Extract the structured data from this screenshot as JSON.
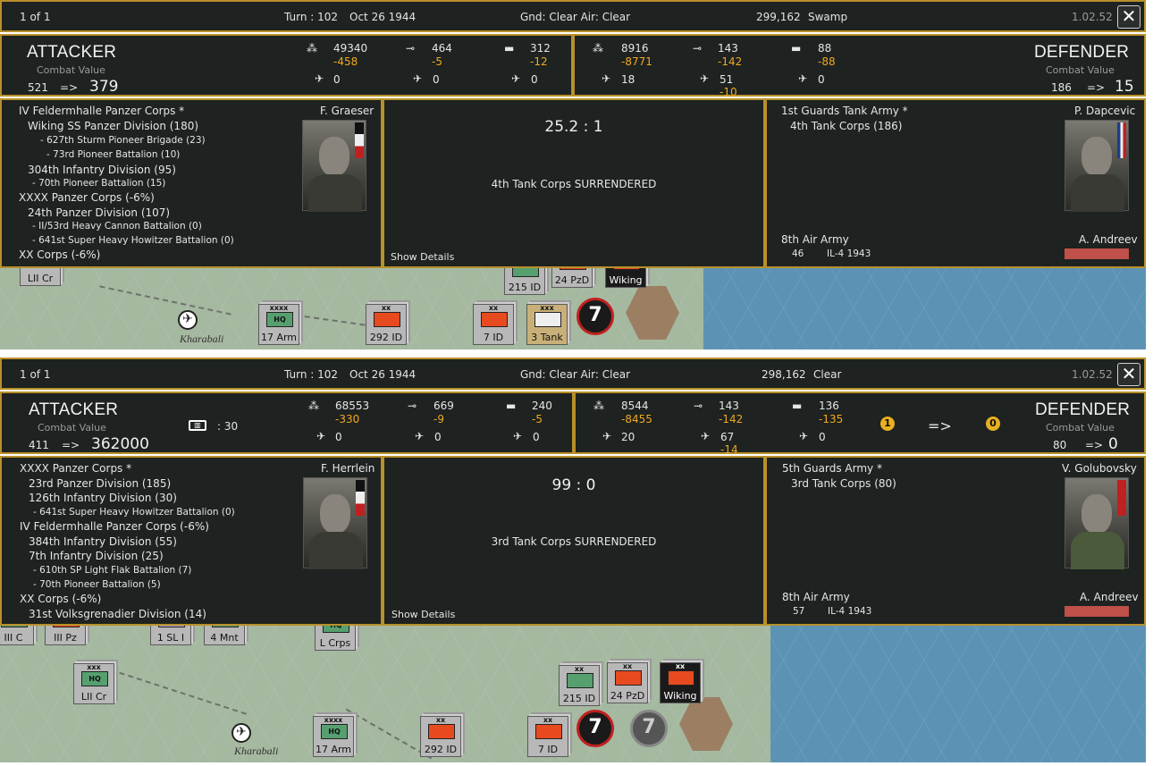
{
  "shots": [
    {
      "topbar": {
        "page": "1 of 1",
        "turn": "Turn : 102",
        "date": "Oct 26 1944",
        "weather": "Gnd: Clear  Air: Clear",
        "hex": "299,162",
        "terrain": "Swamp",
        "version": "1.02.52",
        "close": "✕"
      },
      "attacker": {
        "title": "ATTACKER",
        "cv_label": "Combat Value",
        "cv_before": "521",
        "arrow": "=>",
        "cv_after": "379",
        "men": "49340",
        "men_loss": "-458",
        "guns": "464",
        "guns_loss": "-5",
        "afv": "312",
        "afv_loss": "-12",
        "ftr": "0",
        "bmb": "0",
        "oth": "0",
        "fort_icon": "",
        "fort_value": ""
      },
      "defender": {
        "title": "DEFENDER",
        "cv_label": "Combat Value",
        "cv_before": "186",
        "arrow": "=>",
        "cv_after": "15",
        "men": "8916",
        "men_loss": "-8771",
        "guns": "143",
        "guns_loss": "-142",
        "afv": "88",
        "afv_loss": "-88",
        "ftr": "18",
        "bmb": "51",
        "bmb_loss": "-10",
        "oth": "0"
      },
      "att_panel": {
        "leader": "F. Graeser",
        "rows": [
          {
            "t": "IV Feldermhalle Panzer Corps *",
            "lvl": 0
          },
          {
            "t": "Wiking SS Panzer Division (180)",
            "lvl": 1
          },
          {
            "t": "- 627th Sturm Pioneer Brigade (23)",
            "lvl": 2
          },
          {
            "t": "- 73rd Pioneer Battalion (10)",
            "lvl": 2
          },
          {
            "t": "304th Infantry Division (95)",
            "lvl": 1
          },
          {
            "t": "- 70th Pioneer Battalion (15)",
            "lvl": 2
          },
          {
            "t": "XXXX Panzer Corps (-6%)",
            "lvl": 0
          },
          {
            "t": "24th Panzer Division (107)",
            "lvl": 1
          },
          {
            "t": "- II/53rd Heavy Cannon Battalion (0)",
            "lvl": 2
          },
          {
            "t": "- 641st Super Heavy Howitzer Battalion (0)",
            "lvl": 2
          },
          {
            "t": "XX Corps (-6%)",
            "lvl": 0
          }
        ]
      },
      "mid_panel": {
        "odds": "25.2 : 1",
        "result": "4th Tank Corps SURRENDERED",
        "details": "Show Details"
      },
      "def_panel": {
        "army": "1st Guards Tank Army *",
        "leader": "P. Dapcevic",
        "rows": [
          {
            "t": "4th Tank Corps (186)",
            "lvl": 1
          }
        ],
        "air_army": "8th Air Army",
        "air_leader": "A. Andreev",
        "air_count": "46",
        "air_type": "IL-4 1943"
      },
      "map": {
        "city": "Kharabali",
        "units": [
          {
            "ech": "",
            "sym": "HQ",
            "lbl": "LII Cr",
            "kind": "g"
          },
          {
            "ech": "xxxx",
            "sym": "HQ",
            "lbl": "17 Arm",
            "kind": "g"
          },
          {
            "ech": "xx",
            "sym": "",
            "lbl": "292 ID",
            "kind": "r"
          },
          {
            "ech": "xx",
            "sym": "",
            "lbl": "215 ID",
            "kind": "g"
          },
          {
            "ech": "",
            "sym": "",
            "lbl": "24 PzD",
            "kind": "r"
          },
          {
            "ech": "",
            "sym": "",
            "lbl": "Wiking",
            "kind": "b"
          },
          {
            "ech": "xx",
            "sym": "",
            "lbl": "7 ID",
            "kind": "r"
          },
          {
            "ech": "xxx",
            "sym": "",
            "lbl": "3 Tank",
            "kind": "t"
          }
        ]
      }
    },
    {
      "topbar": {
        "page": "1 of 1",
        "turn": "Turn : 102",
        "date": "Oct 26 1944",
        "weather": "Gnd: Clear  Air: Clear",
        "hex": "298,162",
        "terrain": "Clear",
        "version": "1.02.52",
        "close": "✕"
      },
      "attacker": {
        "title": "ATTACKER",
        "cv_label": "Combat Value",
        "cv_before": "411",
        "arrow": "=>",
        "cv_after": "362000",
        "men": "68553",
        "men_loss": "-330",
        "guns": "669",
        "guns_loss": "-9",
        "afv": "240",
        "afv_loss": "-5",
        "ftr": "0",
        "bmb": "0",
        "oth": "0",
        "fort_icon": "▥",
        "fort_value": ": 30"
      },
      "defender": {
        "title": "DEFENDER",
        "cv_label": "Combat Value",
        "cv_before": "80",
        "arrow": "=>",
        "cv_after": "0",
        "men": "8544",
        "men_loss": "-8455",
        "guns": "143",
        "guns_loss": "-142",
        "afv": "136",
        "afv_loss": "-135",
        "ftr": "20",
        "bmb": "67",
        "bmb_loss": "-14",
        "oth": "0",
        "fort_from": "1",
        "fort_arrow": "=>",
        "fort_to": "0"
      },
      "att_panel": {
        "leader": "F. Herrlein",
        "rows": [
          {
            "t": "XXXX Panzer Corps *",
            "lvl": 0
          },
          {
            "t": "23rd Panzer Division (185)",
            "lvl": 1
          },
          {
            "t": "126th Infantry Division (30)",
            "lvl": 1
          },
          {
            "t": "- 641st Super Heavy Howitzer Battalion (0)",
            "lvl": 2
          },
          {
            "t": "IV Feldermhalle Panzer Corps (-6%)",
            "lvl": 0
          },
          {
            "t": "384th Infantry Division (55)",
            "lvl": 1
          },
          {
            "t": "7th Infantry Division (25)",
            "lvl": 1
          },
          {
            "t": "- 610th SP Light Flak Battalion (7)",
            "lvl": 2
          },
          {
            "t": "- 70th Pioneer Battalion (5)",
            "lvl": 2
          },
          {
            "t": "XX Corps (-6%)",
            "lvl": 0
          },
          {
            "t": "31st Volksgrenadier Division (14)",
            "lvl": 1
          }
        ]
      },
      "mid_panel": {
        "odds": "99 : 0",
        "result": "3rd Tank Corps SURRENDERED",
        "details": "Show Details"
      },
      "def_panel": {
        "army": "5th Guards Army *",
        "leader": "V. Golubovsky",
        "rows": [
          {
            "t": "3rd Tank Corps (80)",
            "lvl": 1
          }
        ],
        "air_army": "8th Air Army",
        "air_leader": "A. Andreev",
        "air_count": "57",
        "air_type": "IL-4 1943"
      },
      "map": {
        "city": "Kharabali",
        "units": [
          {
            "ech": "",
            "sym": "",
            "lbl": "III C",
            "kind": "g"
          },
          {
            "ech": "",
            "sym": "HQ",
            "lbl": "III Pz",
            "kind": "r"
          },
          {
            "ech": "",
            "sym": "",
            "lbl": "1 SL I",
            "kind": "p"
          },
          {
            "ech": "",
            "sym": "",
            "lbl": "4 Mnt",
            "kind": "g"
          },
          {
            "ech": "",
            "sym": "HQ",
            "lbl": "L Crps",
            "kind": "g"
          },
          {
            "ech": "xxx",
            "sym": "HQ",
            "lbl": "LII Cr",
            "kind": "g"
          },
          {
            "ech": "xx",
            "sym": "",
            "lbl": "215 ID",
            "kind": "g"
          },
          {
            "ech": "xx",
            "sym": "",
            "lbl": "24 PzD",
            "kind": "r"
          },
          {
            "ech": "xx",
            "sym": "",
            "lbl": "Wiking",
            "kind": "b"
          },
          {
            "ech": "xxxx",
            "sym": "HQ",
            "lbl": "17 Arm",
            "kind": "g"
          },
          {
            "ech": "xx",
            "sym": "",
            "lbl": "292 ID",
            "kind": "r"
          },
          {
            "ech": "xx",
            "sym": "",
            "lbl": "7 ID",
            "kind": "r"
          }
        ]
      }
    }
  ],
  "colors": {
    "panel_bg": "#1e2220",
    "border_gold": "#b8902a",
    "loss_orange": "#f0a820",
    "water": "#5c93b5",
    "steppe": "#a5b8a0"
  },
  "icons": {
    "men": "infantry-icon",
    "guns": "gun-icon",
    "afv": "tank-icon",
    "ftr": "fighter-icon",
    "bmb": "bomber-icon",
    "oth": "aircraft-icon"
  }
}
